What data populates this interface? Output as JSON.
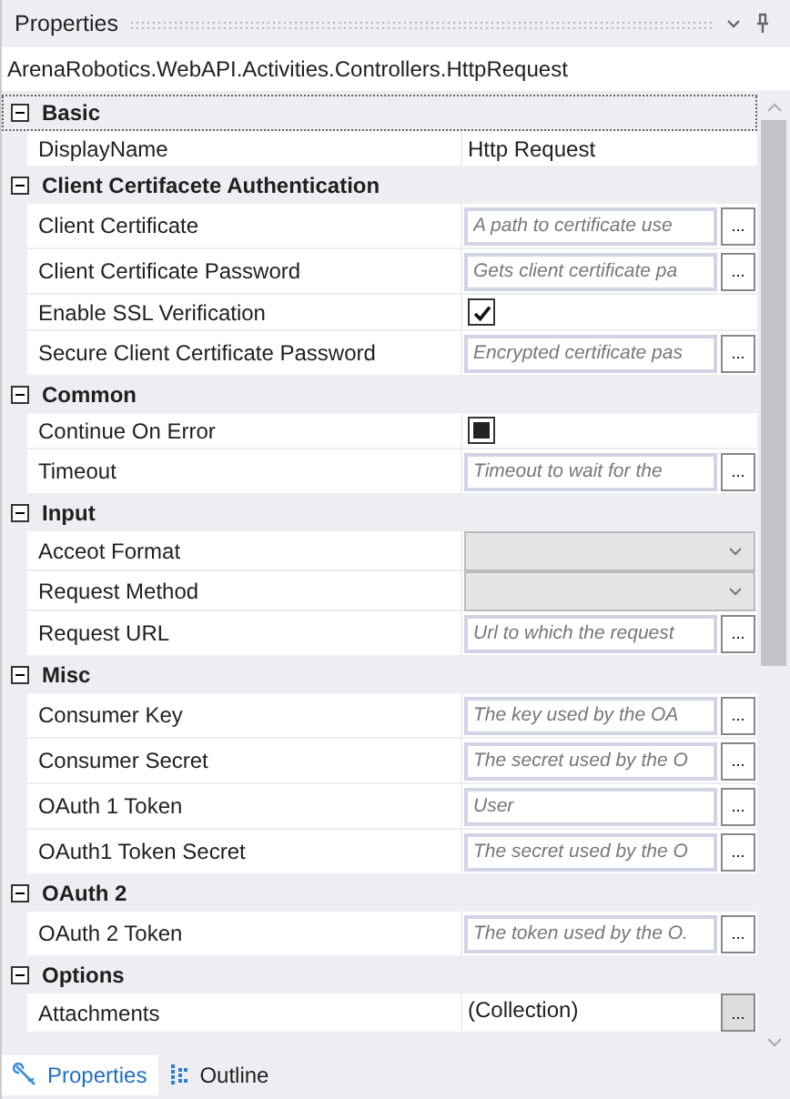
{
  "panel": {
    "title": "Properties"
  },
  "object_name": "ArenaRobotics.WebAPI.Activities.Controllers.HttpRequest",
  "categories": [
    {
      "name": "Basic",
      "expanded": true,
      "focused": true,
      "rows": [
        {
          "kind": "text",
          "label": "DisplayName",
          "value": "Http Request"
        }
      ]
    },
    {
      "name": "Client Certifacete Authentication",
      "expanded": true,
      "focused": false,
      "rows": [
        {
          "kind": "input",
          "label": "Client Certificate",
          "placeholder": "A path to certificate use",
          "button": "..."
        },
        {
          "kind": "input",
          "label": "Client Certificate Password",
          "placeholder": "Gets client certificate pa",
          "button": "..."
        },
        {
          "kind": "checkbox",
          "label": "Enable SSL Verification",
          "checked": true
        },
        {
          "kind": "input",
          "label": "Secure Client Certificate Password",
          "placeholder": "Encrypted certificate pas",
          "button": "..."
        }
      ]
    },
    {
      "name": "Common",
      "expanded": true,
      "focused": false,
      "rows": [
        {
          "kind": "checkbox",
          "label": "Continue On Error",
          "indeterminate": true
        },
        {
          "kind": "input",
          "label": "Timeout",
          "placeholder": "Timeout to wait for the",
          "button": "..."
        }
      ]
    },
    {
      "name": "Input",
      "expanded": true,
      "focused": false,
      "rows": [
        {
          "kind": "dropdown",
          "label": "Acceot Format"
        },
        {
          "kind": "dropdown",
          "label": "Request Method"
        },
        {
          "kind": "input",
          "label": "Request URL",
          "placeholder": "Url to which the request",
          "button": "..."
        }
      ]
    },
    {
      "name": "Misc",
      "expanded": true,
      "focused": false,
      "rows": [
        {
          "kind": "input",
          "label": "Consumer Key",
          "placeholder": "The key used by the OA",
          "button": "..."
        },
        {
          "kind": "input",
          "label": "Consumer Secret",
          "placeholder": "The secret used by the O",
          "button": "..."
        },
        {
          "kind": "input",
          "label": "OAuth 1 Token",
          "placeholder": "User",
          "button": "..."
        },
        {
          "kind": "input",
          "label": "OAuth1 Token Secret",
          "placeholder": "The secret used by the O",
          "button": "..."
        }
      ]
    },
    {
      "name": "OAuth 2",
      "expanded": true,
      "focused": false,
      "rows": [
        {
          "kind": "input",
          "label": "OAuth 2 Token",
          "placeholder": "The token used by the O.",
          "button": "..."
        }
      ]
    },
    {
      "name": "Options",
      "expanded": true,
      "focused": false,
      "rows": [
        {
          "kind": "collection",
          "label": "Attachments",
          "value": "(Collection)",
          "button": "..."
        }
      ]
    }
  ],
  "tabs": [
    {
      "label": "Properties",
      "selected": true
    },
    {
      "label": "Outline",
      "selected": false
    }
  ]
}
